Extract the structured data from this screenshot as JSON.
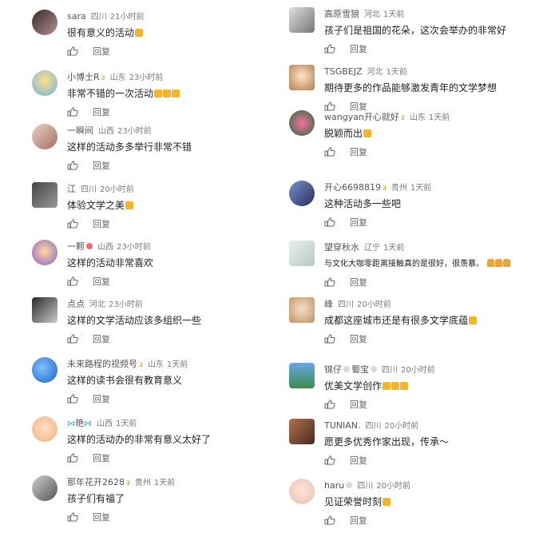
{
  "left": [
    {
      "user": "sara",
      "location": "四川",
      "time": "21小时前",
      "text": "很有意义的活动",
      "emoji": "thumb",
      "reply": "回复"
    },
    {
      "user": "小博士R",
      "badge": "crown",
      "location": "山东",
      "time": "23小时前",
      "text": "非常不错的一次活动",
      "emoji": "thumb3",
      "reply": "回复"
    },
    {
      "user": "一瞬间",
      "location": "山西",
      "time": "23小时前",
      "text": "这样的活动多多举行非常不错",
      "emoji": "",
      "reply": "回复"
    },
    {
      "user": "江",
      "location": "四川",
      "time": "20小时前",
      "text": "体验文学之美",
      "emoji": "thumb",
      "reply": "回复"
    },
    {
      "user": "一颗",
      "badge": "peach",
      "location": "山西",
      "time": "23小时前",
      "text": "这样的活动非常喜欢",
      "emoji": "",
      "reply": "回复"
    },
    {
      "user": "点点",
      "location": "河北",
      "time": "23小时前",
      "text": "这样的文学活动应该多组织一些",
      "emoji": "",
      "reply": "回复"
    },
    {
      "user": "未来路程的视频号",
      "badge": "crown",
      "location": "山东",
      "time": "1天前",
      "text": "这样的读书会很有教育意义",
      "emoji": "",
      "reply": "回复"
    },
    {
      "user": "艳",
      "badge": "ribbon",
      "location": "山西",
      "time": "1天前",
      "text": "这样的活动办的非常有意义太好了",
      "emoji": "",
      "reply": "回复"
    },
    {
      "user": "那年花开2628",
      "badge": "crown",
      "location": "贵州",
      "time": "1天前",
      "text": "孩子们有福了",
      "emoji": "",
      "reply": "回复"
    }
  ],
  "right": [
    {
      "user": "高原雪狼",
      "location": "河北",
      "time": "1天前",
      "text": "孩子们是祖国的花朵，这次会举办的非常好",
      "emoji": "",
      "reply": "回复"
    },
    {
      "user": "TSGBEJZ",
      "location": "河北",
      "time": "1天前",
      "text": "期待更多的作品能够激发青年的文学梦想",
      "emoji": "",
      "reply": "回复"
    },
    {
      "user": "wangyan开心就好",
      "badge": "crown",
      "location": "山东",
      "time": "1天前",
      "text": "脱颖而出",
      "emoji": "thumb",
      "reply": "回复"
    },
    {
      "user": "开心6698819",
      "badge": "crown",
      "location": "贵州",
      "time": "1天前",
      "text": "这种活动多一些吧",
      "emoji": "",
      "reply": "回复"
    },
    {
      "user": "望穿秋水",
      "location": "辽宁",
      "time": "1天前",
      "text": "与文化大咖零距离接触真的是很好，很羡慕。",
      "emoji": "pray3",
      "reply": "回复"
    },
    {
      "user": "峰",
      "location": "四川",
      "time": "20小时前",
      "text": "成都这座城市还是有很多文学底蕴",
      "emoji": "thumb",
      "reply": "回复"
    },
    {
      "user": "锦仔",
      "badge": "bear",
      "location": "四川",
      "time": "20小时前",
      "text": "优美文学创作",
      "emoji": "thumb3",
      "reply": "回复"
    },
    {
      "user": "TUNIAN.",
      "location": "四川",
      "time": "20小时前",
      "text": "愿更多优秀作家出现，传承～",
      "emoji": "",
      "reply": "回复"
    },
    {
      "user": "haru",
      "badge": "bear",
      "location": "四川",
      "time": "20小时前",
      "text": "见证荣誉时刻",
      "emoji": "thumb",
      "reply": "回复"
    }
  ],
  "extra_badges": {
    "bear_left_name": "蜀宝",
    "ribbon": "🎀"
  },
  "colors": {
    "meta": "#7a7a7a",
    "text": "#1f1f1f",
    "crown": "#f0a020",
    "thumb_emoji": "#f3b62b"
  }
}
